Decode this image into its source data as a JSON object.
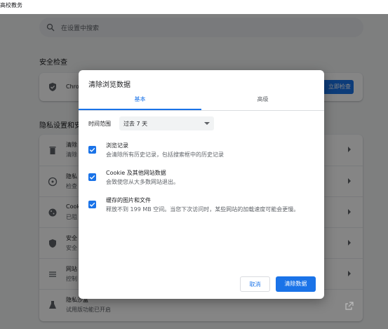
{
  "window": {
    "title": "高校教务"
  },
  "search": {
    "placeholder": "在设置中搜索"
  },
  "safety_check": {
    "heading": "安全检查",
    "row_label": "Chro",
    "button": "立即检查"
  },
  "privacy": {
    "heading": "隐私设置和安",
    "rows": [
      {
        "icon": "trash-icon",
        "title": "清除",
        "desc": "清除"
      },
      {
        "icon": "cookie-icon",
        "title": "隐私",
        "desc": "检查"
      },
      {
        "icon": "cookie-icon",
        "title": "Cook",
        "desc": "已阻"
      },
      {
        "icon": "shield-icon",
        "title": "安全",
        "desc": "安全"
      },
      {
        "icon": "tune-icon",
        "title": "网站",
        "desc": "控制"
      },
      {
        "icon": "flask-icon",
        "title": "隐私沙盒",
        "desc": "试用版功能已开启"
      }
    ]
  },
  "dialog": {
    "title": "清除浏览数据",
    "tabs": [
      {
        "label": "基本",
        "active": true
      },
      {
        "label": "高级",
        "active": false
      }
    ],
    "time_range": {
      "label": "时间范围",
      "value": "过去 7 天"
    },
    "options": [
      {
        "checked": true,
        "title": "浏览记录",
        "desc": "会清除所有历史记录，包括搜索框中的历史记录"
      },
      {
        "checked": true,
        "title": "Cookie 及其他网站数据",
        "desc": "会致使您从大多数网站退出。"
      },
      {
        "checked": true,
        "title": "缓存的图片和文件",
        "desc": "释放不到 199 MB 空间。当您下次访问时，某些网站的加载速度可能会更慢。"
      }
    ],
    "cancel_label": "取消",
    "confirm_label": "清除数据"
  },
  "colors": {
    "accent": "#1a73e8",
    "overlay": "#000000"
  }
}
